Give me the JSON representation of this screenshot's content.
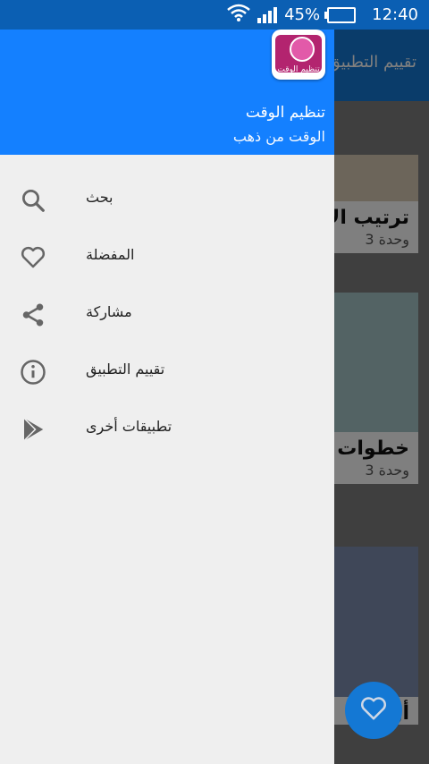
{
  "status_bar": {
    "battery": "45%",
    "time": "12:40"
  },
  "background": {
    "toolbar_title": "تقييم التطبيق",
    "cards": [
      {
        "title": "ترتيب الأولويات",
        "units": "3 وحدة"
      },
      {
        "title": "خطوات عملية للاستفادة",
        "units": "3 وحدة"
      },
      {
        "title": "أو",
        "units": ""
      }
    ]
  },
  "drawer": {
    "logo_text": "تنظيم الوقت",
    "app_name": "تنظيم الوقت",
    "app_subtitle": "الوقت من ذهب",
    "items": [
      {
        "label": "بحث",
        "icon": "search-icon"
      },
      {
        "label": "المفضلة",
        "icon": "heart-icon"
      },
      {
        "label": "مشاركة",
        "icon": "share-icon"
      },
      {
        "label": "تقييم التطبيق",
        "icon": "info-icon"
      },
      {
        "label": "تطبيقات أخرى",
        "icon": "play-store-icon"
      }
    ]
  },
  "colors": {
    "status_bar": "#0b5fb3",
    "header": "#1480ff",
    "drawer_bg": "#efefef",
    "fab": "#1478d4"
  }
}
